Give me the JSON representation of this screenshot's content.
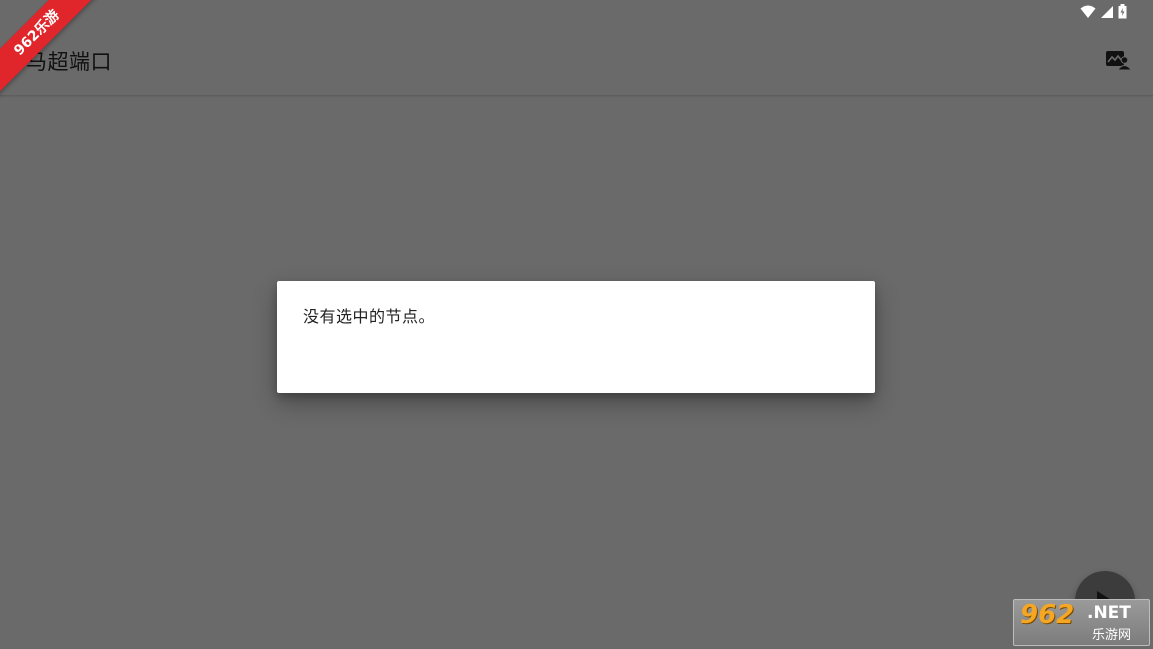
{
  "app_bar": {
    "title": "马超端口",
    "action_icon": "gallery-person-icon"
  },
  "dialog": {
    "message": "没有选中的节点。"
  },
  "fab": {
    "icon": "play-icon"
  },
  "status_bar": {
    "icons": [
      "wifi-icon",
      "cell-signal-icon",
      "battery-icon"
    ]
  },
  "watermarks": {
    "ribbon_text": "962乐游",
    "logo_main": "962",
    "logo_net": ".NET",
    "logo_sub": "乐游网"
  },
  "colors": {
    "scrim_background": "#6a6a6a",
    "dialog_background": "#ffffff",
    "ribbon": "#e0252b"
  }
}
